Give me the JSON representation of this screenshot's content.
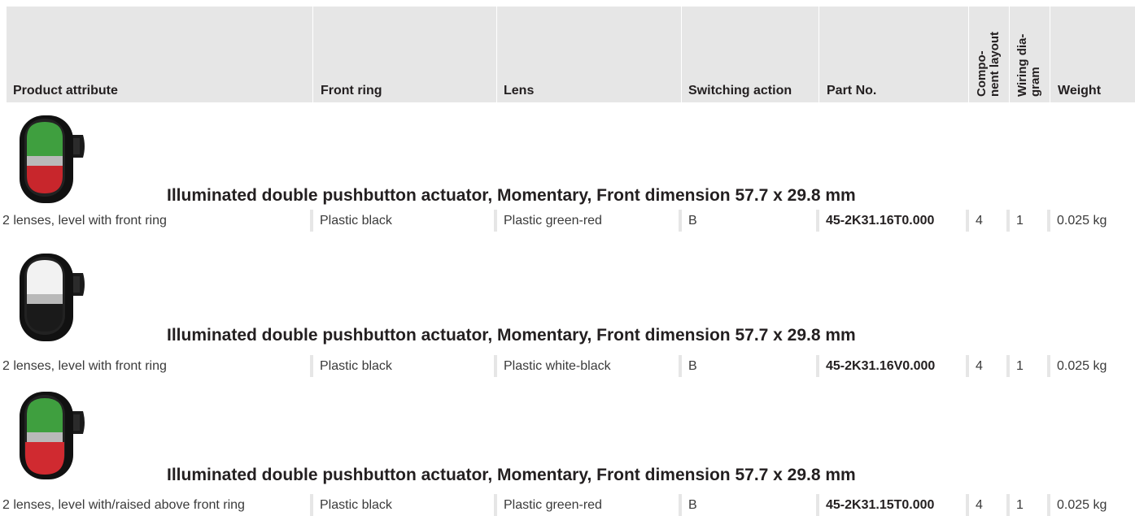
{
  "table": {
    "headers": {
      "product_attribute": "Product attribute",
      "front_ring": "Front ring",
      "lens": "Lens",
      "switching_action": "Switching action",
      "part_no": "Part No.",
      "component_layout_line1": "Compo-",
      "component_layout_line2": "nent layout",
      "wiring_diagram_line1": "Wiring dia-",
      "wiring_diagram_line2": "gram",
      "weight": "Weight"
    },
    "products": [
      {
        "image_icon": "pushbutton-green-red-icon",
        "lens_top_color": "#3f9f3f",
        "lens_bottom_color": "#c8262c",
        "title": "Illuminated double pushbutton actuator, Momentary, Front dimension 57.7 x 29.8 mm",
        "product_attribute": "2 lenses, level with front ring",
        "front_ring": "Plastic black",
        "lens": "Plastic green-red",
        "switching_action": "B",
        "part_no": "45-2K31.16T0.000",
        "component_layout": "4",
        "wiring_diagram": "1",
        "weight": "0.025 kg"
      },
      {
        "image_icon": "pushbutton-white-black-icon",
        "lens_top_color": "#f2f2f2",
        "lens_bottom_color": "#1a1a1a",
        "title": "Illuminated double pushbutton actuator, Momentary, Front dimension 57.7 x 29.8 mm",
        "product_attribute": "2 lenses, level with front ring",
        "front_ring": "Plastic black",
        "lens": "Plastic white-black",
        "switching_action": "B",
        "part_no": "45-2K31.16V0.000",
        "component_layout": "4",
        "wiring_diagram": "1",
        "weight": "0.025 kg"
      },
      {
        "image_icon": "pushbutton-green-red-raised-icon",
        "lens_top_color": "#3f9f3f",
        "lens_bottom_color": "#d02a30",
        "title": "Illuminated double pushbutton actuator, Momentary, Front dimension 57.7 x 29.8 mm",
        "product_attribute": "2 lenses, level with/raised above front ring",
        "front_ring": "Plastic black",
        "lens": "Plastic green-red",
        "switching_action": "B",
        "part_no": "45-2K31.15T0.000",
        "component_layout": "4",
        "wiring_diagram": "1",
        "weight": "0.025 kg"
      }
    ]
  }
}
